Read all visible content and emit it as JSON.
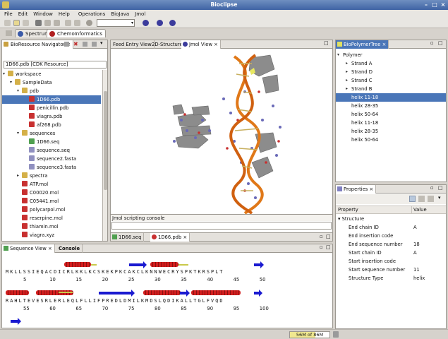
{
  "window": {
    "title": "Bioclipse"
  },
  "menu": [
    "File",
    "Edit",
    "Window",
    "Help",
    "Operations",
    "BioJava",
    "Jmol"
  ],
  "perspectives": [
    {
      "label": "Spectrum",
      "color": "#3a5aa8"
    },
    {
      "label": "ChemoInformatics",
      "color": "#b02020"
    }
  ],
  "navigator": {
    "title": "BioResource Navigator",
    "resource_field": "1D66.pdb [CDK Resource]",
    "tree": [
      {
        "label": "workspace",
        "depth": 0,
        "open": true,
        "kind": "folder"
      },
      {
        "label": "SampleData",
        "depth": 1,
        "open": true,
        "kind": "folder"
      },
      {
        "label": "pdb",
        "depth": 2,
        "open": true,
        "kind": "folder"
      },
      {
        "label": "1D66.pdb",
        "depth": 3,
        "kind": "mol",
        "selected": true
      },
      {
        "label": "penicillin.pdb",
        "depth": 3,
        "kind": "mol"
      },
      {
        "label": "viagra.pdb",
        "depth": 3,
        "kind": "mol"
      },
      {
        "label": "af268.pdb",
        "depth": 3,
        "kind": "mol"
      },
      {
        "label": "sequences",
        "depth": 2,
        "open": true,
        "kind": "folder"
      },
      {
        "label": "1D66.seq",
        "depth": 3,
        "kind": "seq"
      },
      {
        "label": "sequence.seq",
        "depth": 3,
        "kind": "file"
      },
      {
        "label": "sequence2.fasta",
        "depth": 3,
        "kind": "file"
      },
      {
        "label": "sequence3.fasta",
        "depth": 3,
        "kind": "file"
      },
      {
        "label": "spectra",
        "depth": 2,
        "closed": true,
        "kind": "folder"
      },
      {
        "label": "ATP.mol",
        "depth": 2,
        "kind": "mol"
      },
      {
        "label": "C00020.mol",
        "depth": 2,
        "kind": "mol"
      },
      {
        "label": "C05441.mol",
        "depth": 2,
        "kind": "mol"
      },
      {
        "label": "polycarpol.mol",
        "depth": 2,
        "kind": "mol"
      },
      {
        "label": "reserpine.mol",
        "depth": 2,
        "kind": "mol"
      },
      {
        "label": "thiamin.mol",
        "depth": 2,
        "kind": "mol"
      },
      {
        "label": "viagra.xyz",
        "depth": 2,
        "kind": "mol"
      }
    ]
  },
  "editor_tabs": [
    "Feed Entry View",
    "2D-Structure",
    "Jmol View"
  ],
  "scripting_console": {
    "label": "Jmol scripting console"
  },
  "editor_file_tabs": [
    "1D66.seq",
    "1D66.pdb"
  ],
  "polymer_tree": {
    "title": "BioPolymerTree",
    "items": [
      {
        "label": "Polymer",
        "depth": 0,
        "open": true
      },
      {
        "label": "Strand A",
        "depth": 1,
        "closed": true
      },
      {
        "label": "Strand D",
        "depth": 1,
        "closed": true
      },
      {
        "label": "Strand C",
        "depth": 1,
        "closed": true
      },
      {
        "label": "Strand B",
        "depth": 1,
        "closed": true
      },
      {
        "label": "helix 11-18",
        "depth": 1,
        "selected": true
      },
      {
        "label": "helix 28-35",
        "depth": 1
      },
      {
        "label": "helix 50-64",
        "depth": 1
      },
      {
        "label": "helix 11-18",
        "depth": 1
      },
      {
        "label": "helix 28-35",
        "depth": 1
      },
      {
        "label": "helix 50-64",
        "depth": 1
      }
    ]
  },
  "properties": {
    "title": "Properties",
    "headers": [
      "Property",
      "Value"
    ],
    "group": "Structure",
    "rows": [
      {
        "name": "End chain ID",
        "value": "A"
      },
      {
        "name": "End insertion code",
        "value": ""
      },
      {
        "name": "End sequence number",
        "value": "18"
      },
      {
        "name": "Start chain ID",
        "value": "A"
      },
      {
        "name": "Start insertion code",
        "value": ""
      },
      {
        "name": "Start sequence number",
        "value": "11"
      },
      {
        "name": "Structure Type",
        "value": "helix"
      }
    ]
  },
  "bottom_tabs": [
    "Sequence View",
    "Console"
  ],
  "sequence": {
    "line1": "MKLLSSIEQACDICRLKKLKCSKEKPKCAKCLKNNWECRYSPKTKRSPLT",
    "nums1": [
      "5",
      "10",
      "15",
      "20",
      "25",
      "30",
      "35",
      "40",
      "45",
      "50"
    ],
    "line2": "RAHLTEVESRLERLEQLFLLIFPREDLDMILKMDSLQDIKALLTGLFVQD",
    "nums2": [
      "55",
      "60",
      "65",
      "70",
      "75",
      "80",
      "85",
      "90",
      "95",
      "100"
    ]
  },
  "status": {
    "memory": "56M of 86M",
    "memory_fraction": 0.65
  }
}
